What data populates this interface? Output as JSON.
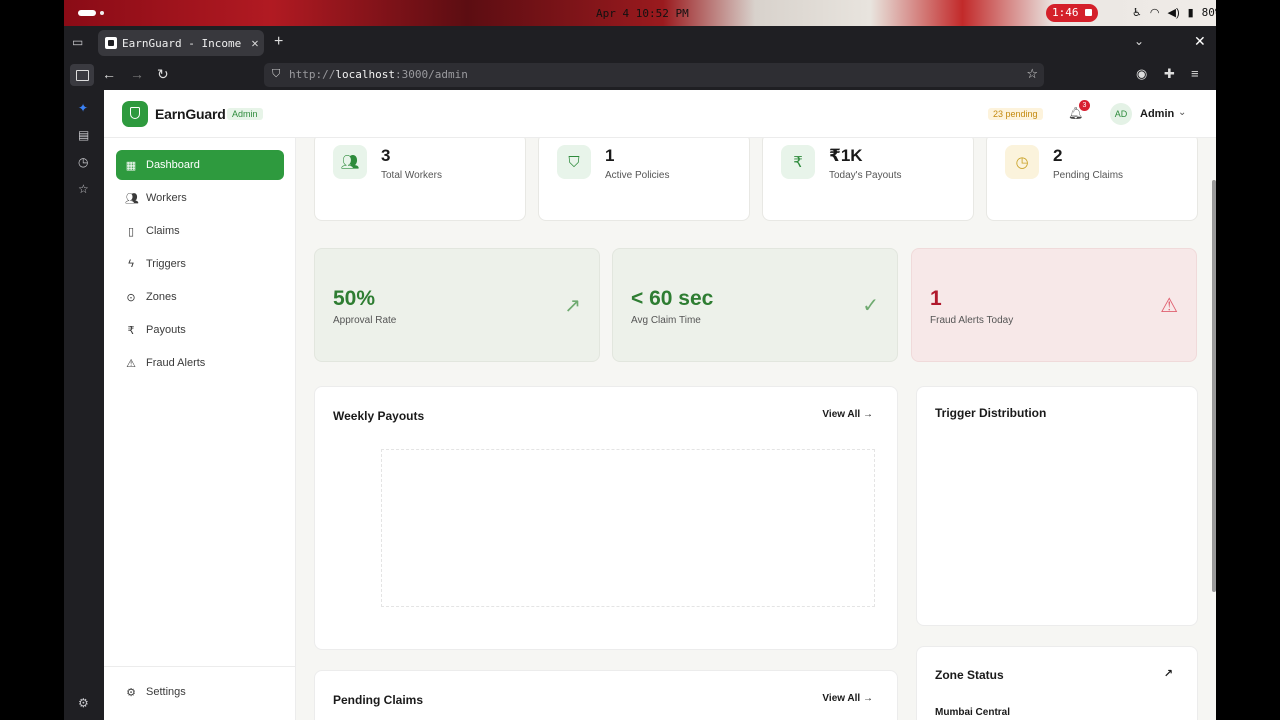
{
  "os": {
    "clock": "Apr 4 10:52 PM",
    "recording_time": "1:46",
    "battery": "80%"
  },
  "browser": {
    "tab_title": "EarnGuard - Income",
    "url_scheme": "http://",
    "url_host": "localhost",
    "url_rest": ":3000/admin"
  },
  "header": {
    "brand": "EarnGuard",
    "role_badge": "Admin",
    "pending": "23 pending",
    "notification_count": "3",
    "avatar_initials": "AD",
    "user_name": "Admin"
  },
  "sidebar": {
    "items": [
      {
        "label": "Dashboard",
        "icon": "grid-icon"
      },
      {
        "label": "Workers",
        "icon": "users-icon"
      },
      {
        "label": "Claims",
        "icon": "document-icon"
      },
      {
        "label": "Triggers",
        "icon": "lightning-icon"
      },
      {
        "label": "Zones",
        "icon": "map-pin-icon"
      },
      {
        "label": "Payouts",
        "icon": "rupee-icon"
      },
      {
        "label": "Fraud Alerts",
        "icon": "warning-icon"
      }
    ],
    "settings_label": "Settings"
  },
  "stats": [
    {
      "value": "3",
      "label": "Total Workers",
      "icon": "users-icon",
      "color": "#2e8b3c",
      "bg": "#e8f4ea"
    },
    {
      "value": "1",
      "label": "Active Policies",
      "icon": "shield-icon",
      "color": "#2e8b3c",
      "bg": "#e8f4ea"
    },
    {
      "value": "₹1K",
      "label": "Today's Payouts",
      "icon": "rupee-icon",
      "color": "#2e8b3c",
      "bg": "#e8f4ea"
    },
    {
      "value": "2",
      "label": "Pending Claims",
      "icon": "clock-icon",
      "color": "#c9a227",
      "bg": "#fbf3dc"
    }
  ],
  "kpis": [
    {
      "value": "50%",
      "label": "Approval Rate",
      "color": "#2e7d32",
      "bg": "#edf1ea"
    },
    {
      "value": "< 60 sec",
      "label": "Avg Claim Time",
      "color": "#2e7d32",
      "bg": "#edf1ea"
    },
    {
      "value": "1",
      "label": "Fraud Alerts Today",
      "color": "#b0182c",
      "bg": "#f7e8e8"
    }
  ],
  "panels": {
    "weekly_payouts": {
      "title": "Weekly Payouts",
      "link": "View All"
    },
    "trigger_distribution": {
      "title": "Trigger Distribution"
    },
    "pending_claims": {
      "title": "Pending Claims",
      "link": "View All"
    },
    "zone_status": {
      "title": "Zone Status",
      "first_zone": "Mumbai Central"
    }
  }
}
